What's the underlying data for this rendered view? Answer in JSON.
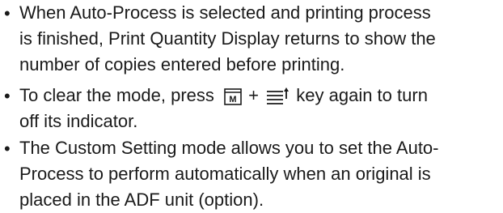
{
  "bullet_glyph": "•",
  "items": [
    {
      "lines": [
        "When Auto-Process is selected and printing process",
        "is finished, Print Quantity Display returns to show the",
        "number of copies entered before printing."
      ]
    },
    {
      "prefix": "To clear the mode, press",
      "key1_letter": "M",
      "plus": "+",
      "suffix": " key again to turn",
      "line2": "off its indicator."
    },
    {
      "lines": [
        "The Custom Setting mode allows you to set the Auto-",
        "Process to perform automatically when an original is",
        "placed in the ADF unit (option)."
      ]
    }
  ]
}
